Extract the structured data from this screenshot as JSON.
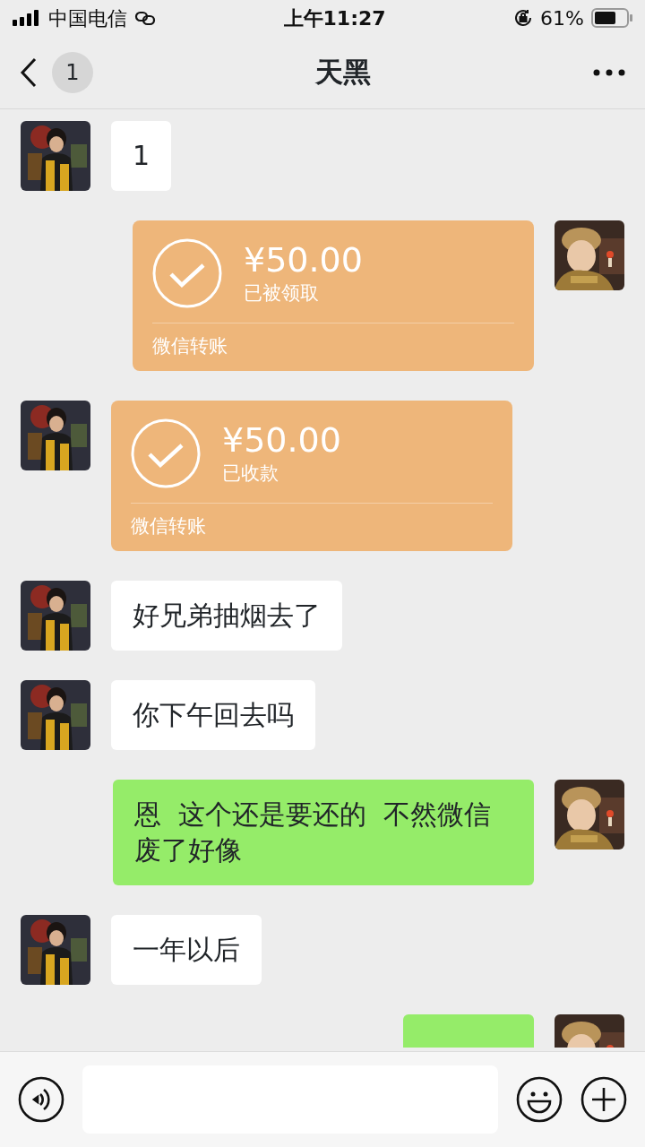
{
  "status_bar": {
    "carrier": "中国电信",
    "time": "上午11:27",
    "battery": "61%"
  },
  "header": {
    "back_badge": "1",
    "title": "天黑"
  },
  "messages": [
    {
      "kind": "text",
      "outgoing": false,
      "text": "1"
    },
    {
      "kind": "transfer",
      "outgoing": true,
      "amount": "¥50.00",
      "status": "已被领取",
      "footer": "微信转账"
    },
    {
      "kind": "transfer",
      "outgoing": false,
      "amount": "¥50.00",
      "status": "已收款",
      "footer": "微信转账"
    },
    {
      "kind": "text",
      "outgoing": false,
      "text": "好兄弟抽烟去了"
    },
    {
      "kind": "text",
      "outgoing": false,
      "text": "你下午回去吗"
    },
    {
      "kind": "text",
      "outgoing": true,
      "text": "恩  这个还是要还的  不然微信废了好像"
    },
    {
      "kind": "text",
      "outgoing": false,
      "text": "一年以后"
    },
    {
      "kind": "cut_off",
      "outgoing": true
    }
  ]
}
